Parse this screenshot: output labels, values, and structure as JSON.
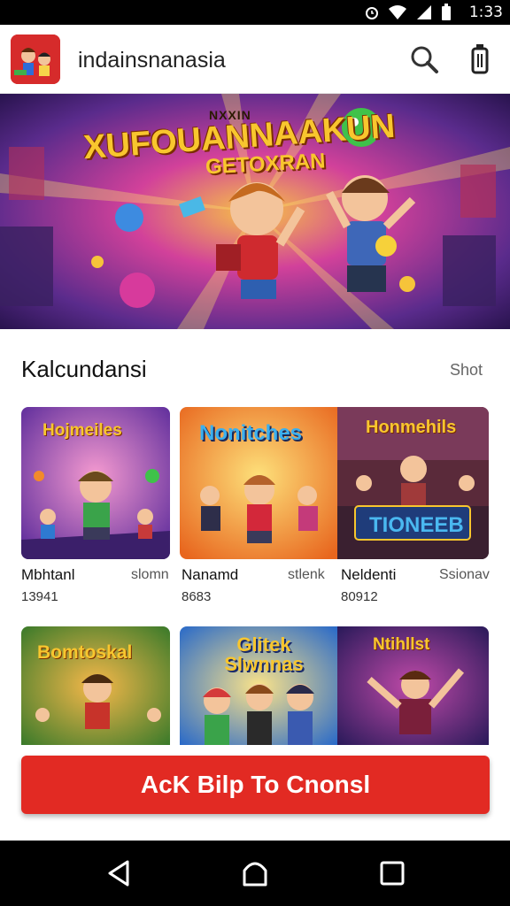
{
  "status_bar": {
    "time": "1:33"
  },
  "app_bar": {
    "title": "indainsnanasia",
    "logo_icon": "game-logo-icon",
    "search_icon": "search-icon",
    "trash_icon": "trash-icon"
  },
  "hero": {
    "title_line1": "XUFOUANNAAKUN",
    "title_line2": "GETOXRAN",
    "corner_text": "NXXIN"
  },
  "section": {
    "title": "Kalcundansi",
    "more": "Shot"
  },
  "games": [
    {
      "name": "Mbhtanl",
      "meta": "slomn",
      "count": "13941",
      "art": "Hojmeiles"
    },
    {
      "name": "Nanamd",
      "meta": "stlenk",
      "count": "8683",
      "art": "Nonitches"
    },
    {
      "name": "Neldenti",
      "meta": "Ssionav",
      "count": "80912",
      "art": "Honmehils",
      "banner": "TIONEEB"
    },
    {
      "name": "",
      "meta": "",
      "count": "",
      "art": "Bomtoskal"
    },
    {
      "name": "",
      "meta": "",
      "count": "",
      "art": "Glitek Slwnnas"
    },
    {
      "name": "",
      "meta": "",
      "count": "",
      "art": "Ntihllst"
    }
  ],
  "cta": {
    "label": "AcK Bilp To Cnonsl"
  },
  "nav": {
    "back_icon": "back-icon",
    "home_icon": "home-icon",
    "recents_icon": "recents-icon"
  },
  "colors": {
    "accent": "#e22a23",
    "status_bg": "#000000",
    "appbar_bg": "#ffffff"
  }
}
